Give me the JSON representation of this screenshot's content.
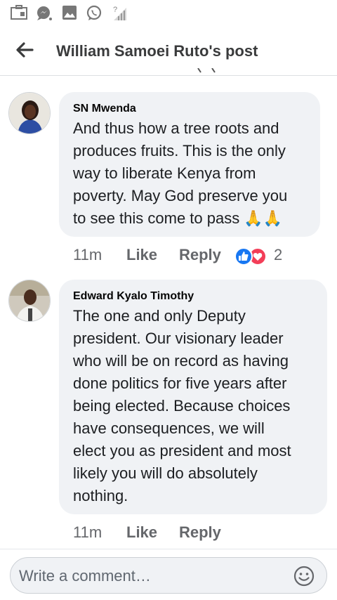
{
  "header": {
    "title": "William Samoei Ruto's post"
  },
  "comments": [
    {
      "author": "SN Mwenda",
      "lines": [
        "And thus how a tree roots and",
        "produces fruits. This is the only",
        "way to liberate Kenya from",
        "poverty. May God preserve you",
        "to see this come to pass"
      ],
      "emoji": "🙏🙏",
      "time": "11m",
      "like_label": "Like",
      "reply_label": "Reply",
      "reaction_count": "2"
    },
    {
      "author": "Edward Kyalo Timothy",
      "lines": [
        "The one and only Deputy",
        "president. Our visionary leader",
        "who will be on record as having",
        "done politics for five years after",
        "being elected. Because choices",
        "have consequences, we will",
        "elect you as president and most",
        "likely you will do absolutely",
        "nothing."
      ],
      "time": "11m",
      "like_label": "Like",
      "reply_label": "Reply"
    }
  ],
  "composer": {
    "placeholder": "Write a comment…"
  },
  "icons": {
    "status": [
      "calendar-icon",
      "messenger-chat-icon",
      "gallery-icon",
      "whatsapp-icon",
      "signal-icon"
    ],
    "back": "back-arrow-icon",
    "emoji": "emoji-smile-icon",
    "reactions": [
      "like-reaction-icon",
      "love-reaction-icon"
    ]
  },
  "colors": {
    "bubble": "#f0f2f5",
    "secondary_text": "#65676b",
    "like_blue": "#1877f2",
    "love_red": "#f33e58"
  }
}
